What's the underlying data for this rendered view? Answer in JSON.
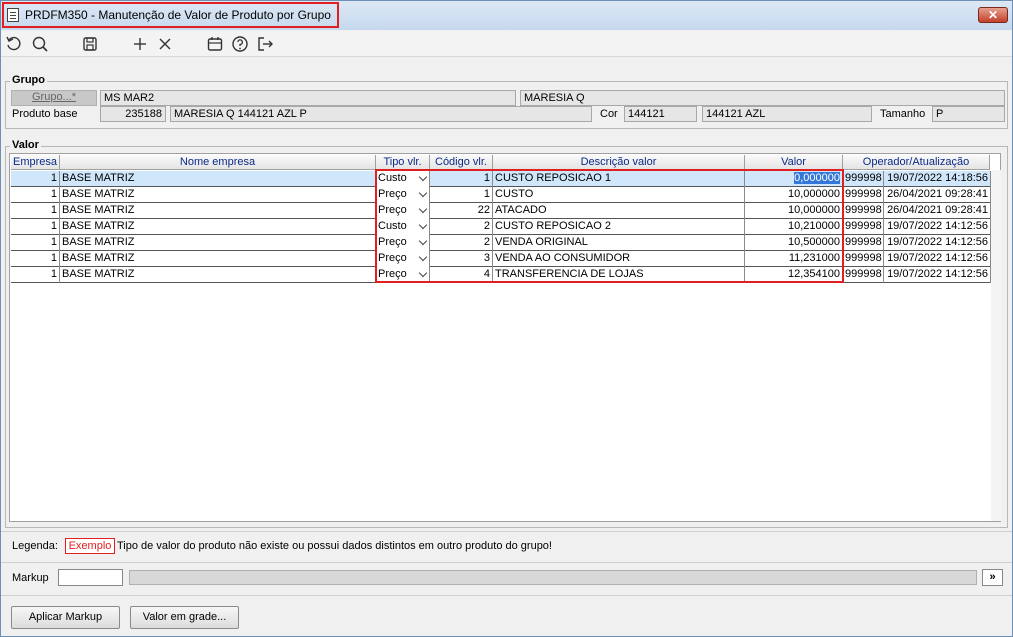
{
  "window": {
    "title": "PRDFM350 - Manutenção de Valor de Produto por Grupo",
    "close_label": "✕"
  },
  "toolbar": {
    "icons": [
      "refresh-icon",
      "search-icon",
      "save-icon",
      "add-icon",
      "delete-icon",
      "calendar-icon",
      "help-icon",
      "exit-icon"
    ]
  },
  "grupo": {
    "section_label": "Grupo",
    "button_label": "Grupo...*",
    "grupo_codigo": "MS MAR2",
    "grupo_nome": "MARESIA Q",
    "produto_label": "Produto base",
    "produto_codigo": "235188",
    "produto_desc": "MARESIA Q 144121 AZL P",
    "cor_label": "Cor",
    "cor_codigo": "144121",
    "cor_desc": "144121 AZL",
    "tamanho_label": "Tamanho",
    "tamanho_valor": "P"
  },
  "valor": {
    "section_label": "Valor",
    "columns": [
      "Empresa",
      "Nome empresa",
      "Tipo vlr.",
      "Código vlr.",
      "Descrição valor",
      "Valor",
      "Operador/Atualização"
    ],
    "rows": [
      {
        "empresa": "1",
        "nome": "BASE MATRIZ",
        "tipo": "Custo",
        "codigo": "1",
        "descricao": "CUSTO REPOSICAO 1",
        "valor": "0,000000",
        "operador": "999998",
        "atualizacao": "19/07/2022 14:18:56"
      },
      {
        "empresa": "1",
        "nome": "BASE MATRIZ",
        "tipo": "Preço",
        "codigo": "1",
        "descricao": "CUSTO",
        "valor": "10,000000",
        "operador": "999998",
        "atualizacao": "26/04/2021 09:28:41"
      },
      {
        "empresa": "1",
        "nome": "BASE MATRIZ",
        "tipo": "Preço",
        "codigo": "22",
        "descricao": "ATACADO",
        "valor": "10,000000",
        "operador": "999998",
        "atualizacao": "26/04/2021 09:28:41"
      },
      {
        "empresa": "1",
        "nome": "BASE MATRIZ",
        "tipo": "Custo",
        "codigo": "2",
        "descricao": "CUSTO REPOSICAO 2",
        "valor": "10,210000",
        "operador": "999998",
        "atualizacao": "19/07/2022 14:12:56"
      },
      {
        "empresa": "1",
        "nome": "BASE MATRIZ",
        "tipo": "Preço",
        "codigo": "2",
        "descricao": "VENDA ORIGINAL",
        "valor": "10,500000",
        "operador": "999998",
        "atualizacao": "19/07/2022 14:12:56"
      },
      {
        "empresa": "1",
        "nome": "BASE MATRIZ",
        "tipo": "Preço",
        "codigo": "3",
        "descricao": "VENDA AO CONSUMIDOR",
        "valor": "11,231000",
        "operador": "999998",
        "atualizacao": "19/07/2022 14:12:56"
      },
      {
        "empresa": "1",
        "nome": "BASE MATRIZ",
        "tipo": "Preço",
        "codigo": "4",
        "descricao": "TRANSFERENCIA DE LOJAS",
        "valor": "12,354100",
        "operador": "999998",
        "atualizacao": "19/07/2022 14:12:56"
      }
    ]
  },
  "legenda": {
    "label": "Legenda:",
    "example": "Exemplo",
    "text": "Tipo de valor do produto não existe ou possui dados distintos em outro produto do grupo!"
  },
  "markup": {
    "label": "Markup",
    "value": "",
    "expand_label": "»"
  },
  "buttons": {
    "aplicar": "Aplicar Markup",
    "valor_grade": "Valor em grade..."
  },
  "colors": {
    "highlight_red": "#e02020",
    "selected_row": "#cfe6fb",
    "selected_value": "#3378d8",
    "header_text": "#0a2a8a"
  }
}
